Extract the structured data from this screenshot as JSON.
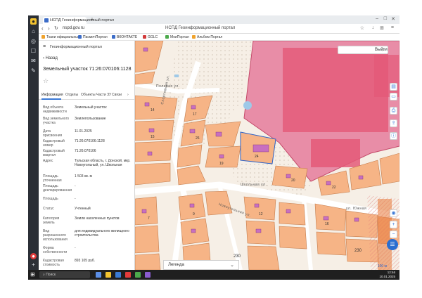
{
  "browser": {
    "tab_title": "НСПД Геоинформационный портал",
    "new_tab": "+",
    "url": "nspd.gov.ru",
    "page_title": "НСПД Геоинформационный портал",
    "bookmarks": [
      {
        "label": "Ткани официальные",
        "color": "#f0a22b"
      },
      {
        "label": "ПасмичПортал",
        "color": "#3b6cc8"
      },
      {
        "label": "ВКОНТАКТЕ",
        "color": "#3b6cc8"
      },
      {
        "label": "GGLC",
        "color": "#d23b3b"
      },
      {
        "label": "МоиПортал",
        "color": "#4caa4c"
      },
      {
        "label": "Альбом Портал",
        "color": "#f0a22b"
      }
    ]
  },
  "panel": {
    "header": "Геоинформационный портал",
    "back_label": "Назад",
    "title": "Земельный участок 71:26:070106:1128",
    "tabs": [
      "Информация",
      "Отделы",
      "Объекты",
      "Части ЗУ",
      "Связи",
      "›"
    ],
    "rows": [
      {
        "label": "Вид объекта недвижимости",
        "value": "Земельный участок"
      },
      {
        "label": "Вид земельного участка",
        "value": "Землепользование"
      },
      {
        "label": "Дата присвоения",
        "value": "11.01.2025"
      },
      {
        "label": "Кадастровый номер",
        "value": "71:26:070106:1128"
      },
      {
        "label": "Кадастровый квартал",
        "value": "71:26:070106"
      },
      {
        "label": "Адрес",
        "value": "Тульская область, г. Донской, мкр. Новоугольный, ул. Школьная"
      },
      {
        "label": "Площадь уточненная",
        "value": "1 503 кв. м"
      },
      {
        "label": "Площадь декларированная",
        "value": "-"
      },
      {
        "label": "Площадь",
        "value": "-"
      },
      {
        "label": "Статус",
        "value": "Учтенный"
      },
      {
        "label": "Категория земель",
        "value": "Земли населенных пунктов"
      },
      {
        "label": "Вид разрешенного использования",
        "value": "для индивидуального жилищного строительства"
      },
      {
        "label": "Форма собственности",
        "value": "-"
      },
      {
        "label": "Кадастровая стоимость",
        "value": "893 105 руб."
      }
    ]
  },
  "map": {
    "search_label": "Выйти",
    "legend_label": "Легенда",
    "street_labels": [
      "Спортивная ул.",
      "Полевая ул.",
      "Школьная ул.",
      "Новоугольная ул.",
      "ул. Южная"
    ],
    "parcel_labels": [
      "230",
      "230",
      "14",
      "15",
      "17",
      "26",
      "19",
      "24",
      "20",
      "22",
      "7",
      "9",
      "12",
      "16"
    ],
    "scale_label": "100 м"
  },
  "taskbar": {
    "search_placeholder": "Поиск",
    "time": "12:46",
    "date": "10.01.2025"
  }
}
